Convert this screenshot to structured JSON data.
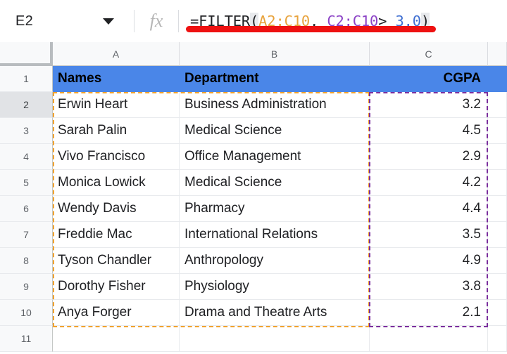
{
  "formula_bar": {
    "name_box_value": "E2",
    "name_box_icon": "chevron-down-icon",
    "fx_label": "fx",
    "formula_tokens": [
      {
        "text": "=FILTER",
        "type": "plain"
      },
      {
        "text": "(",
        "type": "paren"
      },
      {
        "text": "A2:C10",
        "type": "range-a"
      },
      {
        "text": ", ",
        "type": "plain"
      },
      {
        "text": "C2:C10",
        "type": "range-b"
      },
      {
        "text": "> ",
        "type": "plain"
      },
      {
        "text": "3.0",
        "type": "num"
      },
      {
        "text": ")",
        "type": "paren"
      }
    ],
    "formula_plain": "=FILTER(A2:C10, C2:C10> 3.0)",
    "annotation_color": "#ee1111"
  },
  "sheet": {
    "column_headers": [
      "A",
      "B",
      "C",
      ""
    ],
    "header_fill_color": "#4a86e8",
    "range_a_color": "#f0a22e",
    "range_c_color": "#7b2f9e",
    "active_row": "2",
    "rows": [
      {
        "num": "1",
        "a": "Names",
        "b": "Department",
        "c": "CGPA",
        "header": true
      },
      {
        "num": "2",
        "a": "Erwin Heart",
        "b": "Business Administration",
        "c": "3.2",
        "header": false
      },
      {
        "num": "3",
        "a": "Sarah Palin",
        "b": "Medical Science",
        "c": "4.5",
        "header": false
      },
      {
        "num": "4",
        "a": "Vivo Francisco",
        "b": "Office Management",
        "c": "2.9",
        "header": false
      },
      {
        "num": "5",
        "a": "Monica Lowick",
        "b": "Medical Science",
        "c": "4.2",
        "header": false
      },
      {
        "num": "6",
        "a": "Wendy Davis",
        "b": "Pharmacy",
        "c": "4.4",
        "header": false
      },
      {
        "num": "7",
        "a": "Freddie Mac",
        "b": "International Relations",
        "c": "3.5",
        "header": false
      },
      {
        "num": "8",
        "a": "Tyson Chandler",
        "b": "Anthropology",
        "c": "4.9",
        "header": false
      },
      {
        "num": "9",
        "a": "Dorothy Fisher",
        "b": "Physiology",
        "c": "3.8",
        "header": false
      },
      {
        "num": "10",
        "a": "Anya Forger",
        "b": "Drama and Theatre Arts",
        "c": "2.1",
        "header": false
      },
      {
        "num": "11",
        "a": "",
        "b": "",
        "c": "",
        "header": false
      }
    ]
  }
}
